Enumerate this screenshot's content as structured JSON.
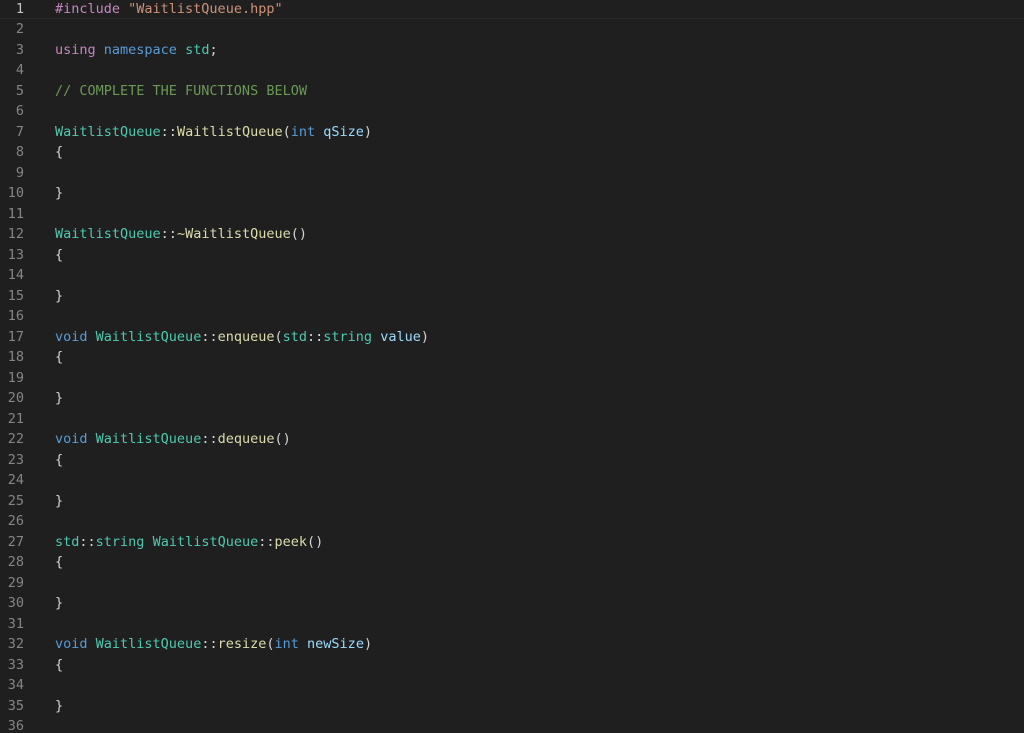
{
  "editor": {
    "colors": {
      "background": "#1f1f1f",
      "line_number": "#858585",
      "line_number_active": "#c6c6c6",
      "preprocessor": "#c586c0",
      "string": "#ce9178",
      "keyword": "#c586c0",
      "storage": "#569cd6",
      "type": "#4ec9b0",
      "function": "#dcdcaa",
      "parameter": "#9cdcfe",
      "comment": "#6a9955",
      "punctuation": "#d4d4d4"
    },
    "current_line": 1,
    "lines": [
      {
        "number": "1",
        "tokens": [
          {
            "t": "#include ",
            "c": "preproc"
          },
          {
            "t": "\"WaitlistQueue.hpp\"",
            "c": "string"
          }
        ]
      },
      {
        "number": "2",
        "tokens": []
      },
      {
        "number": "3",
        "tokens": [
          {
            "t": "using",
            "c": "keyword"
          },
          {
            "t": " ",
            "c": "punct"
          },
          {
            "t": "namespace",
            "c": "storage"
          },
          {
            "t": " ",
            "c": "punct"
          },
          {
            "t": "std",
            "c": "namespace"
          },
          {
            "t": ";",
            "c": "punct"
          }
        ]
      },
      {
        "number": "4",
        "tokens": []
      },
      {
        "number": "5",
        "tokens": [
          {
            "t": "// COMPLETE THE FUNCTIONS BELOW",
            "c": "comment"
          }
        ]
      },
      {
        "number": "6",
        "tokens": []
      },
      {
        "number": "7",
        "tokens": [
          {
            "t": "WaitlistQueue",
            "c": "type"
          },
          {
            "t": "::",
            "c": "punct"
          },
          {
            "t": "WaitlistQueue",
            "c": "function"
          },
          {
            "t": "(",
            "c": "punct"
          },
          {
            "t": "int",
            "c": "storage"
          },
          {
            "t": " ",
            "c": "punct"
          },
          {
            "t": "qSize",
            "c": "param"
          },
          {
            "t": ")",
            "c": "punct"
          }
        ]
      },
      {
        "number": "8",
        "tokens": [
          {
            "t": "{",
            "c": "punct"
          }
        ]
      },
      {
        "number": "9",
        "tokens": []
      },
      {
        "number": "10",
        "tokens": [
          {
            "t": "}",
            "c": "punct"
          }
        ]
      },
      {
        "number": "11",
        "tokens": []
      },
      {
        "number": "12",
        "tokens": [
          {
            "t": "WaitlistQueue",
            "c": "type"
          },
          {
            "t": "::",
            "c": "punct"
          },
          {
            "t": "~WaitlistQueue",
            "c": "function"
          },
          {
            "t": "()",
            "c": "punct"
          }
        ]
      },
      {
        "number": "13",
        "tokens": [
          {
            "t": "{",
            "c": "punct"
          }
        ]
      },
      {
        "number": "14",
        "tokens": []
      },
      {
        "number": "15",
        "tokens": [
          {
            "t": "}",
            "c": "punct"
          }
        ]
      },
      {
        "number": "16",
        "tokens": []
      },
      {
        "number": "17",
        "tokens": [
          {
            "t": "void",
            "c": "storage"
          },
          {
            "t": " ",
            "c": "punct"
          },
          {
            "t": "WaitlistQueue",
            "c": "type"
          },
          {
            "t": "::",
            "c": "punct"
          },
          {
            "t": "enqueue",
            "c": "function"
          },
          {
            "t": "(",
            "c": "punct"
          },
          {
            "t": "std",
            "c": "namespace"
          },
          {
            "t": "::",
            "c": "punct"
          },
          {
            "t": "string",
            "c": "type"
          },
          {
            "t": " ",
            "c": "punct"
          },
          {
            "t": "value",
            "c": "param"
          },
          {
            "t": ")",
            "c": "punct"
          }
        ]
      },
      {
        "number": "18",
        "tokens": [
          {
            "t": "{",
            "c": "punct"
          }
        ]
      },
      {
        "number": "19",
        "tokens": []
      },
      {
        "number": "20",
        "tokens": [
          {
            "t": "}",
            "c": "punct"
          }
        ]
      },
      {
        "number": "21",
        "tokens": []
      },
      {
        "number": "22",
        "tokens": [
          {
            "t": "void",
            "c": "storage"
          },
          {
            "t": " ",
            "c": "punct"
          },
          {
            "t": "WaitlistQueue",
            "c": "type"
          },
          {
            "t": "::",
            "c": "punct"
          },
          {
            "t": "dequeue",
            "c": "function"
          },
          {
            "t": "()",
            "c": "punct"
          }
        ]
      },
      {
        "number": "23",
        "tokens": [
          {
            "t": "{",
            "c": "punct"
          }
        ]
      },
      {
        "number": "24",
        "tokens": []
      },
      {
        "number": "25",
        "tokens": [
          {
            "t": "}",
            "c": "punct"
          }
        ]
      },
      {
        "number": "26",
        "tokens": []
      },
      {
        "number": "27",
        "tokens": [
          {
            "t": "std",
            "c": "namespace"
          },
          {
            "t": "::",
            "c": "punct"
          },
          {
            "t": "string",
            "c": "type"
          },
          {
            "t": " ",
            "c": "punct"
          },
          {
            "t": "WaitlistQueue",
            "c": "type"
          },
          {
            "t": "::",
            "c": "punct"
          },
          {
            "t": "peek",
            "c": "function"
          },
          {
            "t": "()",
            "c": "punct"
          }
        ]
      },
      {
        "number": "28",
        "tokens": [
          {
            "t": "{",
            "c": "punct"
          }
        ]
      },
      {
        "number": "29",
        "tokens": []
      },
      {
        "number": "30",
        "tokens": [
          {
            "t": "}",
            "c": "punct"
          }
        ]
      },
      {
        "number": "31",
        "tokens": []
      },
      {
        "number": "32",
        "tokens": [
          {
            "t": "void",
            "c": "storage"
          },
          {
            "t": " ",
            "c": "punct"
          },
          {
            "t": "WaitlistQueue",
            "c": "type"
          },
          {
            "t": "::",
            "c": "punct"
          },
          {
            "t": "resize",
            "c": "function"
          },
          {
            "t": "(",
            "c": "punct"
          },
          {
            "t": "int",
            "c": "storage"
          },
          {
            "t": " ",
            "c": "punct"
          },
          {
            "t": "newSize",
            "c": "param"
          },
          {
            "t": ")",
            "c": "punct"
          }
        ]
      },
      {
        "number": "33",
        "tokens": [
          {
            "t": "{",
            "c": "punct"
          }
        ]
      },
      {
        "number": "34",
        "tokens": []
      },
      {
        "number": "35",
        "tokens": [
          {
            "t": "}",
            "c": "punct"
          }
        ]
      },
      {
        "number": "36",
        "tokens": []
      }
    ]
  }
}
